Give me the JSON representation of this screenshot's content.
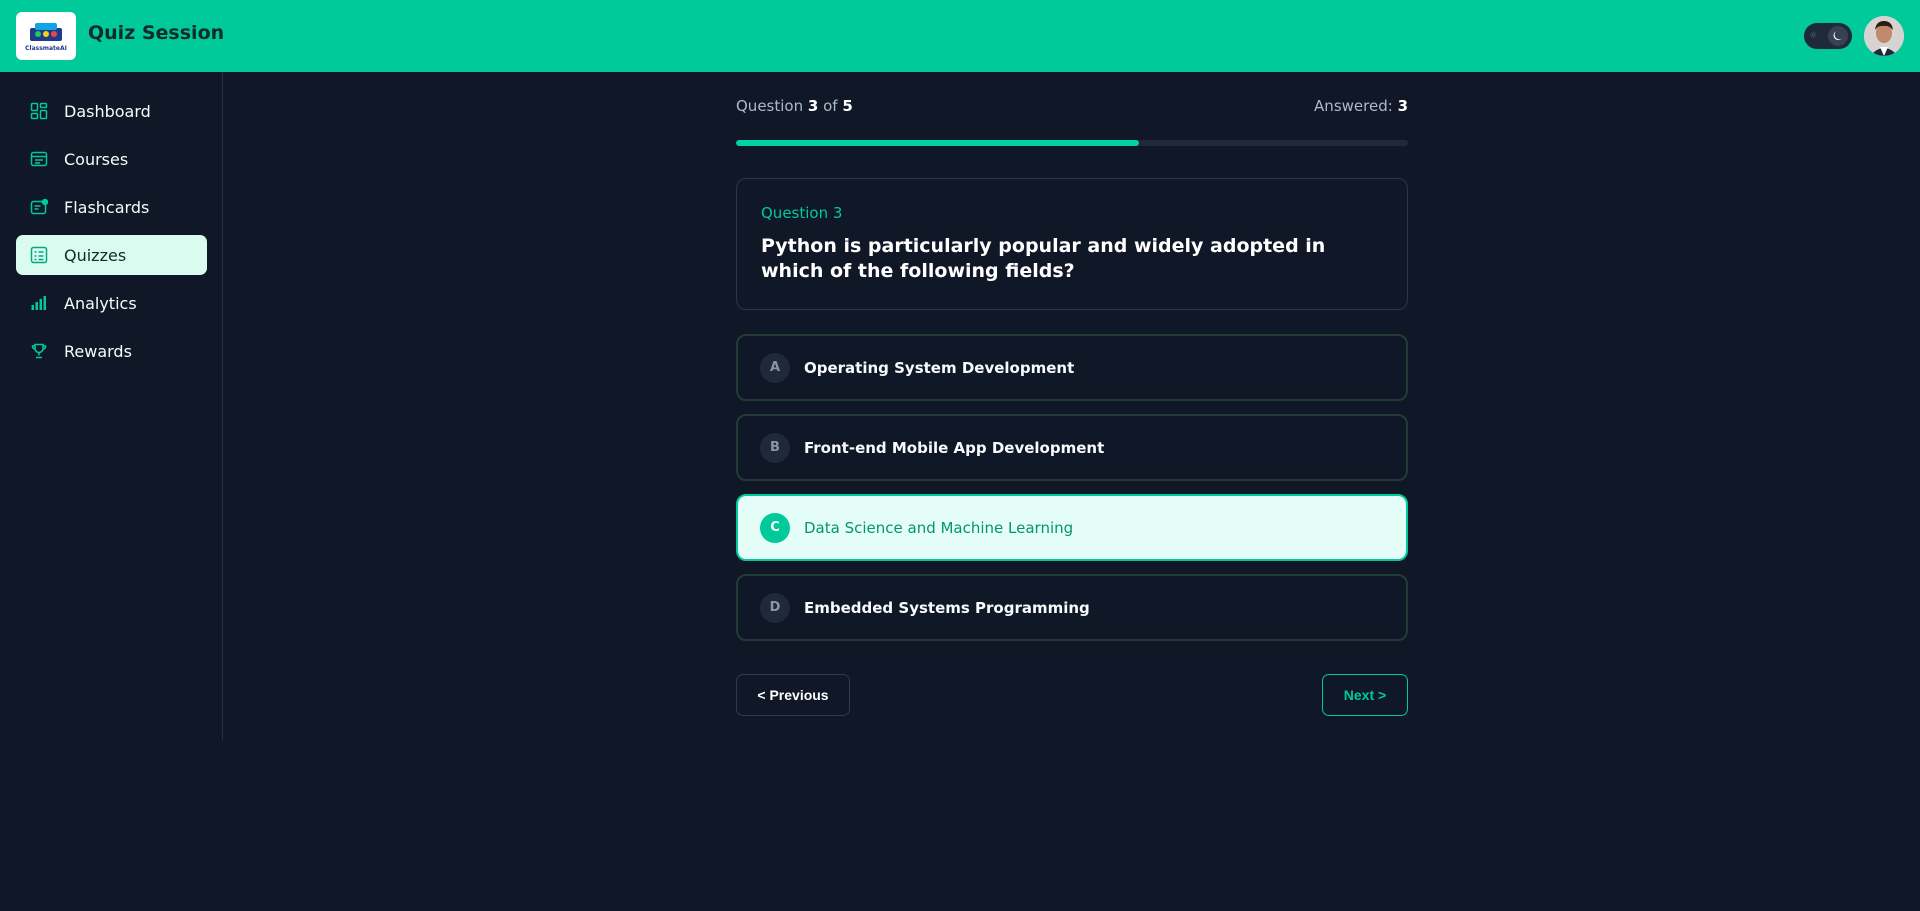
{
  "header": {
    "app_title": "Quiz Session",
    "logo_text": "ClassmateAI",
    "accent_color": "#00c99a"
  },
  "sidebar": {
    "items": [
      {
        "label": "Dashboard",
        "icon": "dashboard-icon"
      },
      {
        "label": "Courses",
        "icon": "courses-icon"
      },
      {
        "label": "Flashcards",
        "icon": "flashcards-icon"
      },
      {
        "label": "Quizzes",
        "icon": "quizzes-icon",
        "active": true
      },
      {
        "label": "Analytics",
        "icon": "analytics-icon"
      },
      {
        "label": "Rewards",
        "icon": "trophy-icon"
      }
    ]
  },
  "progress": {
    "question_prefix": "Question",
    "current": "3",
    "of_word": "of",
    "total": "5",
    "answered_label": "Answered:",
    "answered_count": "3",
    "fill_fraction": 0.6
  },
  "question": {
    "label": "Question 3",
    "text": "Python is particularly popular and widely adopted in which of the following fields?"
  },
  "options": [
    {
      "letter": "A",
      "text": "Operating System Development"
    },
    {
      "letter": "B",
      "text": "Front-end Mobile App Development"
    },
    {
      "letter": "C",
      "text": "Data Science and Machine Learning",
      "selected": true
    },
    {
      "letter": "D",
      "text": "Embedded Systems Programming"
    }
  ],
  "nav": {
    "previous_label": "< Previous",
    "next_label": "Next >"
  }
}
